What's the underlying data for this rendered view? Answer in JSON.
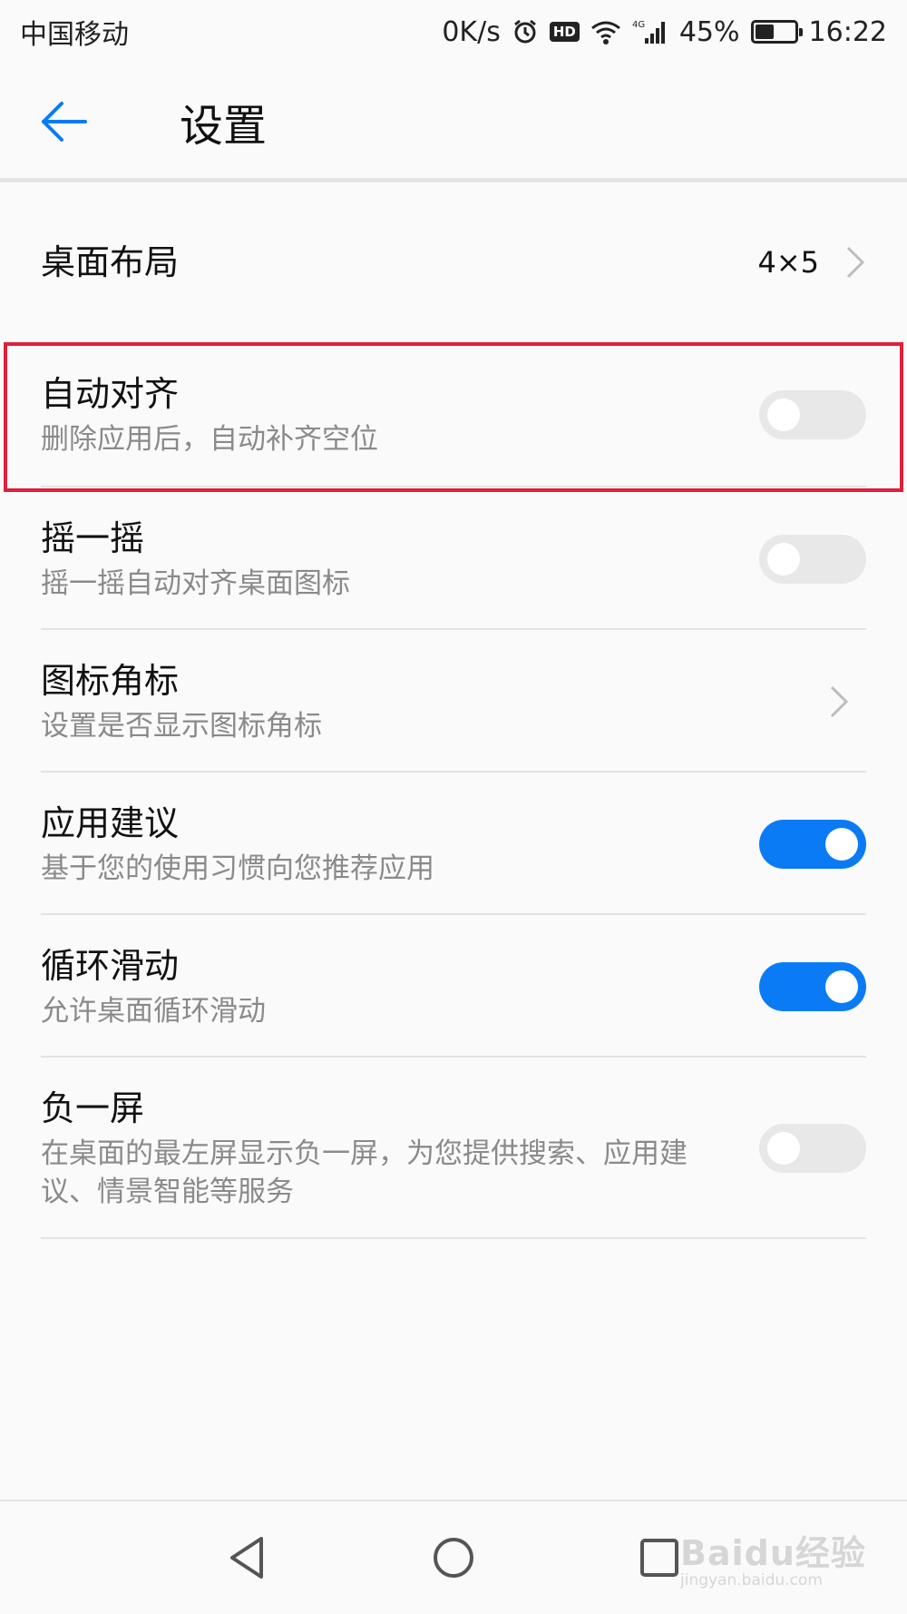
{
  "status_bar": {
    "carrier": "中国移动",
    "net_speed": "0K/s",
    "hd_badge": "HD",
    "signal_tech": "4G",
    "battery": "45%",
    "battery_level": 0.45,
    "time": "16:22"
  },
  "header": {
    "title": "设置"
  },
  "settings": {
    "desktop_layout": {
      "title": "桌面布局",
      "value": "4×5"
    },
    "auto_align": {
      "title": "自动对齐",
      "subtitle": "删除应用后，自动补齐空位",
      "enabled": false
    },
    "shake": {
      "title": "摇一摇",
      "subtitle": "摇一摇自动对齐桌面图标",
      "enabled": false
    },
    "icon_badge": {
      "title": "图标角标",
      "subtitle": "设置是否显示图标角标"
    },
    "app_suggestions": {
      "title": "应用建议",
      "subtitle": "基于您的使用习惯向您推荐应用",
      "enabled": true
    },
    "loop_scroll": {
      "title": "循环滑动",
      "subtitle": "允许桌面循环滑动",
      "enabled": true
    },
    "minus_one_screen": {
      "title": "负一屏",
      "subtitle": "在桌面的最左屏显示负一屏，为您提供搜索、应用建议、情景智能等服务",
      "enabled": false
    }
  },
  "watermark": {
    "main": "Baidu经验",
    "sub": "jingyan.baidu.com"
  },
  "colors": {
    "accent": "#0a7bf5",
    "highlight": "#e0203a",
    "toggle_off": "#e8e8e8"
  }
}
